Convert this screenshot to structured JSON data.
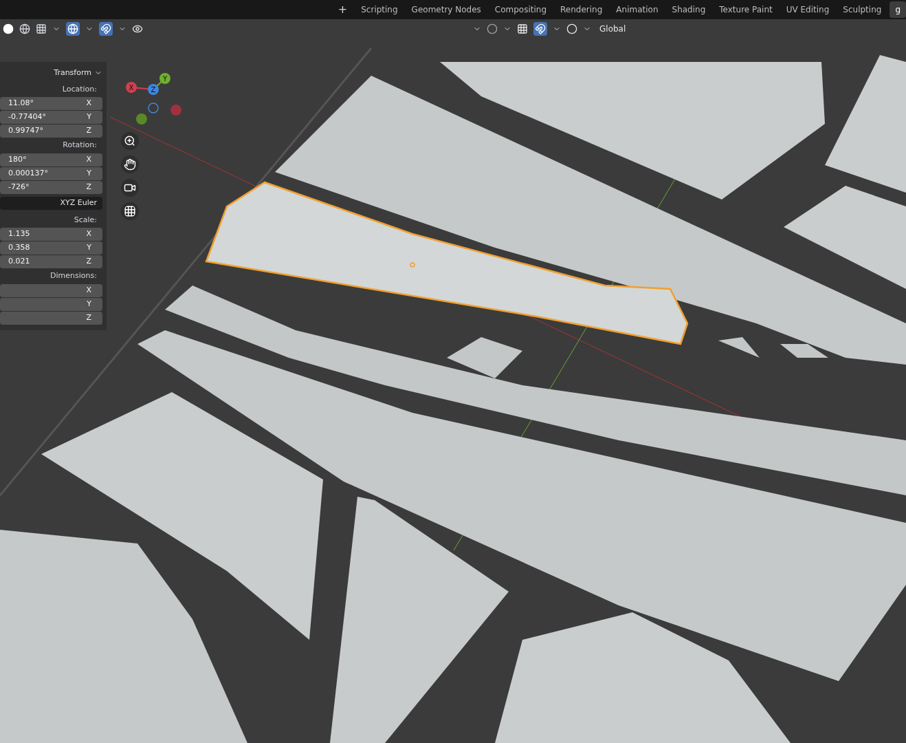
{
  "workspace_tabs": [
    {
      "label": "Scripting",
      "selected": false
    },
    {
      "label": "Geometry Nodes",
      "selected": false
    },
    {
      "label": "Compositing",
      "selected": false
    },
    {
      "label": "Rendering",
      "selected": false
    },
    {
      "label": "Animation",
      "selected": false
    },
    {
      "label": "Shading",
      "selected": false
    },
    {
      "label": "Texture Paint",
      "selected": false
    },
    {
      "label": "UV Editing",
      "selected": false
    },
    {
      "label": "Sculpting",
      "selected": false
    },
    {
      "label": "g",
      "selected": true
    }
  ],
  "add_tab": "+",
  "header": {
    "orientation": "Global"
  },
  "gizmo": {
    "x": "X",
    "y": "Y",
    "z": "Z"
  },
  "transform_panel": {
    "title": "Transform",
    "expanded": true,
    "sections": [
      {
        "kind": "vector",
        "label": "Location:",
        "fields": [
          {
            "axis": "X",
            "value": "11.08°"
          },
          {
            "axis": "Y",
            "value": "-0.77404°"
          },
          {
            "axis": "Z",
            "value": "0.99747°"
          }
        ]
      },
      {
        "kind": "vector",
        "label": "Rotation:",
        "fields": [
          {
            "axis": "X",
            "value": "180°"
          },
          {
            "axis": "Y",
            "value": "0.000137°"
          },
          {
            "axis": "Z",
            "value": "-726°"
          }
        ]
      },
      {
        "kind": "dropdown",
        "value": "XYZ Euler"
      },
      {
        "kind": "vector",
        "label": "Scale:",
        "fields": [
          {
            "axis": "X",
            "value": "1.135"
          },
          {
            "axis": "Y",
            "value": "0.358"
          },
          {
            "axis": "Z",
            "value": "0.021"
          }
        ]
      },
      {
        "kind": "vector",
        "label": "Dimensions:",
        "fields": [
          {
            "axis": "X"
          },
          {
            "axis": "Y"
          },
          {
            "axis": "Z"
          }
        ]
      }
    ]
  }
}
